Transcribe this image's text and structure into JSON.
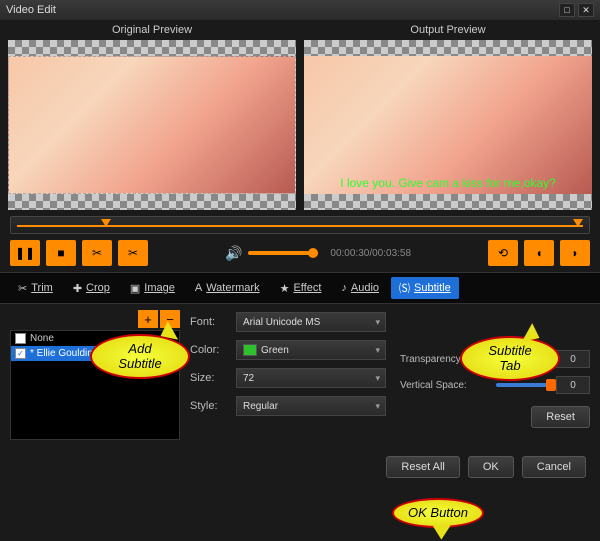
{
  "window": {
    "title": "Video Edit"
  },
  "preview": {
    "original_label": "Original Preview",
    "output_label": "Output Preview",
    "subtitle_text": "I love you. Give cam a kiss for me,okay?"
  },
  "playback": {
    "timecode": "00:00:30/00:03:58",
    "buttons": {
      "pause": "❚❚",
      "stop": "■",
      "cut_in": "✂",
      "cut_out": "✂",
      "undo": "⟲",
      "bracket_l": "◖",
      "bracket_r": "◗"
    }
  },
  "tabs": [
    {
      "icon": "✂",
      "label": "Trim"
    },
    {
      "icon": "✚",
      "label": "Crop"
    },
    {
      "icon": "▣",
      "label": "Image"
    },
    {
      "icon": "A",
      "label": "Watermark"
    },
    {
      "icon": "★",
      "label": "Effect"
    },
    {
      "icon": "♪",
      "label": "Audio"
    },
    {
      "icon": "🄢",
      "label": "Subtitle",
      "active": true
    }
  ],
  "subtitles": {
    "add_remove": {
      "add": "+",
      "remove": "−"
    },
    "items": [
      {
        "checked": false,
        "label": "None"
      },
      {
        "checked": true,
        "label": "* Ellie Goulding - Burn.srt",
        "selected": true
      }
    ]
  },
  "form": {
    "font": {
      "label": "Font:",
      "value": "Arial Unicode MS"
    },
    "color": {
      "label": "Color:",
      "value": "Green",
      "hex": "#2dc22d"
    },
    "size": {
      "label": "Size:",
      "value": "72"
    },
    "style": {
      "label": "Style:",
      "value": "Regular"
    }
  },
  "sliders": {
    "transparency": {
      "label": "Transparency:",
      "value": "0",
      "percent": 5
    },
    "vertical_space": {
      "label": "Vertical Space:",
      "value": "0",
      "percent": 95
    }
  },
  "buttons": {
    "reset": "Reset",
    "reset_all": "Reset All",
    "ok": "OK",
    "cancel": "Cancel"
  },
  "callouts": {
    "add_subtitle": "Add Subtitle",
    "subtitle_tab": "Subtitle Tab",
    "ok_button": "OK Button"
  }
}
